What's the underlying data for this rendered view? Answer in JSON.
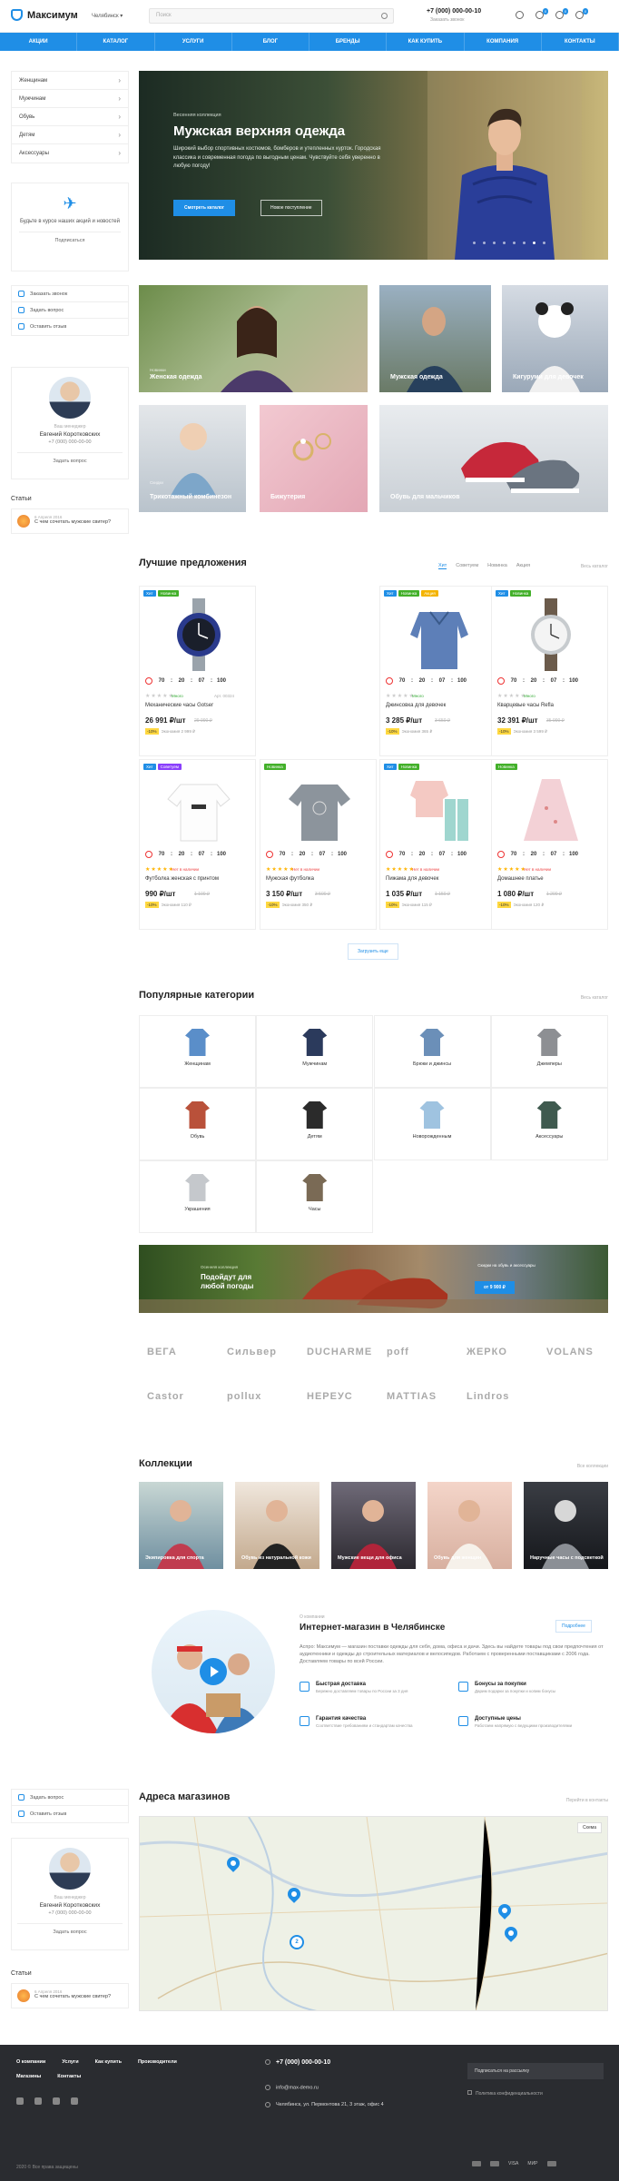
{
  "header": {
    "logo": "Максимум",
    "city": "Челябинск",
    "search_placeholder": "Поиск",
    "phone": "+7 (000) 000-00-10",
    "callback": "Заказать звонок",
    "badges": [
      "0",
      "0",
      "0"
    ]
  },
  "nav": [
    "Акции",
    "Каталог",
    "Услуги",
    "Блог",
    "Бренды",
    "Как купить",
    "Компания",
    "Контакты"
  ],
  "sidebar": {
    "menu": [
      "Женщинам",
      "Мужчинам",
      "Обувь",
      "Детям",
      "Аксессуары"
    ],
    "subscribe_text": "Будьте в курсе наших акций и новостей",
    "subscribe_link": "Подписаться",
    "actions": [
      "Заказать звонок",
      "Задать вопрос",
      "Оставить отзыв"
    ],
    "manager": {
      "role": "Ваш менеджер",
      "name": "Евгений Коротковских",
      "phone": "+7 (000) 000-00-00",
      "button": "Задать вопрос"
    },
    "articles_title": "Статьи",
    "article": {
      "date": "6 Апреля 2016",
      "title": "С чем сочетать мужские свитер?"
    }
  },
  "hero": {
    "subtitle": "Весенняя коллекция",
    "title": "Мужская верхняя одежда",
    "text": "Широкий выбор спортивных костюмов, бомберов и утепленных курток. Городская классика и современная погода по выгодным ценам. Чувствуйте себя уверенно в любую погоду!",
    "btn_primary": "Смотреть каталог",
    "btn_secondary": "Новое поступление"
  },
  "tiles": [
    {
      "sub": "Новинки",
      "label": "Женская одежда"
    },
    {
      "sub": "",
      "label": "Мужская одежда"
    },
    {
      "sub": "",
      "label": "Кигуруми для девочек"
    },
    {
      "sub": "Скидки",
      "label": "Трикотажный комбинезон"
    },
    {
      "sub": "",
      "label": "Бижутерия"
    },
    {
      "sub": "",
      "label": "Обувь для мальчиков"
    }
  ],
  "best": {
    "title": "Лучшие предложения",
    "tabs": [
      "Хит",
      "Советуем",
      "Новинка",
      "Акция"
    ],
    "all": "Весь каталог",
    "more": "Загрузить еще"
  },
  "products": [
    {
      "badges": [
        "Хит",
        "Новинка"
      ],
      "timer": [
        "70",
        "20",
        "07",
        "100"
      ],
      "name": "Механические часы Gotser",
      "price": "26 991 ₽/шт",
      "old": "29 990 ₽",
      "save": "Экономия 2 999 ₽",
      "pct": "-10%",
      "stock": "Много",
      "art": "Арт. 00324"
    },
    {
      "badges": [
        "Хит",
        "Новинка",
        "Акция"
      ],
      "timer": [
        "70",
        "20",
        "07",
        "100"
      ],
      "name": "Джинсовка для девочек",
      "price": "3 285 ₽/шт",
      "old": "3 650 ₽",
      "save": "Экономия 365 ₽",
      "pct": "-10%",
      "stock": "Много",
      "art": ""
    },
    {
      "badges": [
        "Хит",
        "Новинка"
      ],
      "timer": [
        "70",
        "20",
        "07",
        "100"
      ],
      "name": "Кварцевые часы Refla",
      "price": "32 391 ₽/шт",
      "old": "35 990 ₽",
      "save": "Экономия 3 599 ₽",
      "pct": "-10%",
      "stock": "Много",
      "art": ""
    },
    {
      "badges": [
        "Хит",
        "Советуем"
      ],
      "timer": [
        "70",
        "20",
        "07",
        "100"
      ],
      "name": "Футболка женская с принтом",
      "price": "990 ₽/шт",
      "old": "1 100 ₽",
      "save": "Экономия 110 ₽",
      "pct": "-10%",
      "stock": "Нет в наличии",
      "art": ""
    },
    {
      "badges": [
        "Новинка"
      ],
      "timer": [
        "70",
        "20",
        "07",
        "100"
      ],
      "name": "Мужская футболка",
      "price": "3 150 ₽/шт",
      "old": "3 500 ₽",
      "save": "Экономия 350 ₽",
      "pct": "-10%",
      "stock": "Нет в наличии",
      "art": ""
    },
    {
      "badges": [
        "Хит",
        "Новинка"
      ],
      "timer": [
        "70",
        "20",
        "07",
        "100"
      ],
      "name": "Пижама для девочек",
      "price": "1 035 ₽/шт",
      "old": "1 150 ₽",
      "save": "Экономия 115 ₽",
      "pct": "-10%",
      "stock": "Нет в наличии",
      "art": ""
    },
    {
      "badges": [
        "Новинка"
      ],
      "timer": [
        "70",
        "20",
        "07",
        "100"
      ],
      "name": "Домашнее платье",
      "price": "1 080 ₽/шт",
      "old": "1 200 ₽",
      "save": "Экономия 120 ₽",
      "pct": "-10%",
      "stock": "Нет в наличии",
      "art": ""
    }
  ],
  "popular": {
    "title": "Популярные категории",
    "all": "Весь каталог",
    "items": [
      "Женщинам",
      "Мужчинам",
      "Брюки и джинсы",
      "Джемперы",
      "Обувь",
      "Детям",
      "Новорожденным",
      "Аксессуары",
      "Украшения",
      "Часы"
    ]
  },
  "banner": {
    "sub": "Осенняя коллекция",
    "title": "Подойдут для любой погоды",
    "right": "Скидки на обувь и аксессуары",
    "price": "от 9 900 ₽"
  },
  "brands": [
    "ВЕГА",
    "Сильвер",
    "DUCHARME",
    "poff",
    "ЖЕРКО",
    "VOLANS",
    "Castor",
    "pollux",
    "НЕРЕУС",
    "MATTIAS",
    "Lindros"
  ],
  "collections": {
    "title": "Коллекции",
    "all": "Все коллекции",
    "items": [
      "Экипировка для спорта",
      "Обувь из натуральной кожи",
      "Мужские вещи для офиса",
      "Обувь для женщин",
      "Наручные часы с подсветкой"
    ]
  },
  "about": {
    "sub": "О компании",
    "title": "Интернет-магазин в Челябинске",
    "btn": "Подробнее",
    "text": "Аспро: Максимум — магазин поставки одежды для себя, дома, офиса и дачи. Здесь вы найдете товары под свои предпочтения от аудиотехники и одежды до строительных материалов и велосипедов. Работаем с проверенными поставщиками с 2006 года. Доставляем товары по всей России.",
    "features": [
      {
        "t": "Быстрая доставка",
        "d": "Бережно доставляем товары по России за 3 дня"
      },
      {
        "t": "Бонусы за покупки",
        "d": "Дарим подарки за покупки и копим бонусы"
      },
      {
        "t": "Гарантия качества",
        "d": "Соответствие требованиям и стандартам качества"
      },
      {
        "t": "Доступные цены",
        "d": "Работаем напрямую с ведущими производителями"
      }
    ]
  },
  "map": {
    "title": "Адреса магазинов",
    "all": "Перейти в контакты",
    "type": "Схема",
    "cluster": "2"
  },
  "footer": {
    "nav1": [
      "О компании",
      "Услуги",
      "Как купить",
      "Производители"
    ],
    "nav2": [
      "Магазины",
      "Контакты"
    ],
    "phone": "+7 (000) 000-00-10",
    "email": "info@max-demo.ru",
    "address": "Челябинск, ул. Пермонтова 21, 3 этаж, офис 4",
    "subscribe": "Подписаться на рассылку",
    "privacy": "Политика конфиденциальности",
    "copyright": "2020 © Все права защищены",
    "pay": [
      "VISA",
      "МИР"
    ]
  }
}
